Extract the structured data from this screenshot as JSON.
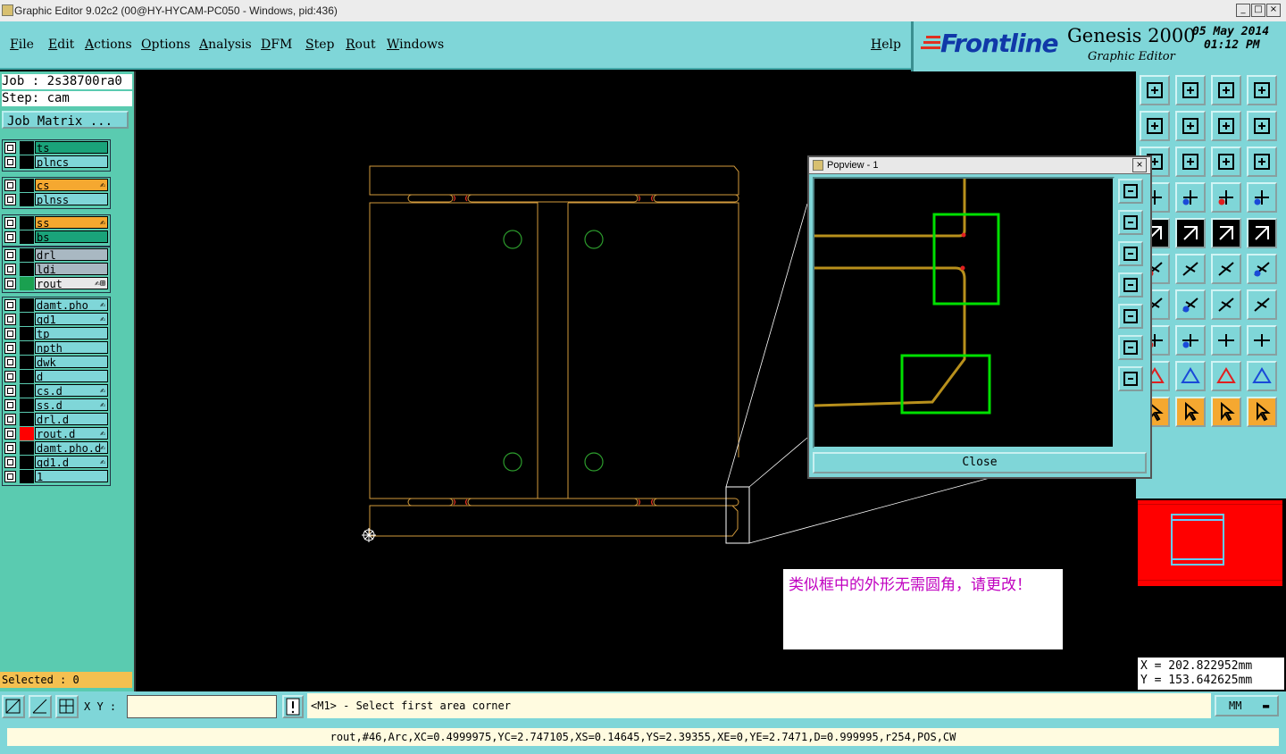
{
  "window": {
    "title": "Graphic Editor 9.02c2 (00@HY-HYCAM-PC050 - Windows, pid:436)",
    "controls": [
      "_",
      "□",
      "×"
    ]
  },
  "menu": [
    "File",
    "Edit",
    "Actions",
    "Options",
    "Analysis",
    "DFM",
    "Step",
    "Rout",
    "Windows"
  ],
  "help_label": "Help",
  "brand": {
    "logo": "Frontline",
    "product": "Genesis 2000",
    "subtitle": "Graphic Editor",
    "date": "05 May 2014",
    "time": "01:12 PM"
  },
  "job": {
    "job_line": "Job : 2s38700ra0",
    "step_line": "Step: cam"
  },
  "job_matrix_label": "Job Matrix ...",
  "layers": [
    {
      "name": "ts",
      "color": "#1aa37a",
      "mark": ""
    },
    {
      "name": "plncs",
      "color": "#7fd6d8",
      "mark": ""
    },
    {
      "name": "cs",
      "color": "#f5a830",
      "mark": "✍"
    },
    {
      "name": "plnss",
      "color": "#7fd6d8",
      "mark": ""
    },
    {
      "name": "ss",
      "color": "#f5a830",
      "mark": "✍"
    },
    {
      "name": "bs",
      "color": "#1aa37a",
      "mark": ""
    },
    {
      "name": "drl",
      "color": "#a9b8c2",
      "mark": ""
    },
    {
      "name": "ldi",
      "color": "#a9b8c2",
      "mark": ""
    },
    {
      "name": "rout",
      "color": "#e8e8e8",
      "mark": "✍⊞",
      "active": true
    },
    {
      "name": "damt.pho",
      "color": "#7fd6d8",
      "mark": "✍"
    },
    {
      "name": "gd1",
      "color": "#7fd6d8",
      "mark": "✍"
    },
    {
      "name": "tp",
      "color": "#7fd6d8",
      "mark": ""
    },
    {
      "name": "npth",
      "color": "#7fd6d8",
      "mark": ""
    },
    {
      "name": "dwk",
      "color": "#7fd6d8",
      "mark": ""
    },
    {
      "name": "d",
      "color": "#7fd6d8",
      "mark": ""
    },
    {
      "name": "cs.d",
      "color": "#7fd6d8",
      "mark": "✍"
    },
    {
      "name": "ss.d",
      "color": "#7fd6d8",
      "mark": "✍"
    },
    {
      "name": "drl.d",
      "color": "#7fd6d8",
      "mark": ""
    },
    {
      "name": "rout.d",
      "color": "#7fd6d8",
      "mark": "✍",
      "swatch": "#ff0000"
    },
    {
      "name": "damt.pho.d",
      "color": "#7fd6d8",
      "mark": "✍"
    },
    {
      "name": "gd1.d",
      "color": "#7fd6d8",
      "mark": "✍"
    },
    {
      "name": "1",
      "color": "#7fd6d8",
      "mark": ""
    }
  ],
  "selected_label": "Selected : 0",
  "popview": {
    "title": "Popview - 1",
    "close_label": "Close"
  },
  "note": "类似框中的外形无需圆角，请更改！",
  "coords": {
    "x": "X  =  202.822952mm",
    "y": "Y  =  153.642625mm"
  },
  "xy_label": "X Y :",
  "xy_value": "",
  "prompt": "<M1> - Select first area corner",
  "unit": "MM",
  "status": "rout,#46,Arc,XC=0.4999975,YC=2.747105,XS=0.14645,YS=2.39355,XE=0,YE=2.7471,D=0.999995,r254,POS,CW",
  "colors": {
    "panel": "#7fd6d8",
    "left_panel": "#5acbb0",
    "outline": "#d29a3c",
    "highlight": "#00e000"
  }
}
